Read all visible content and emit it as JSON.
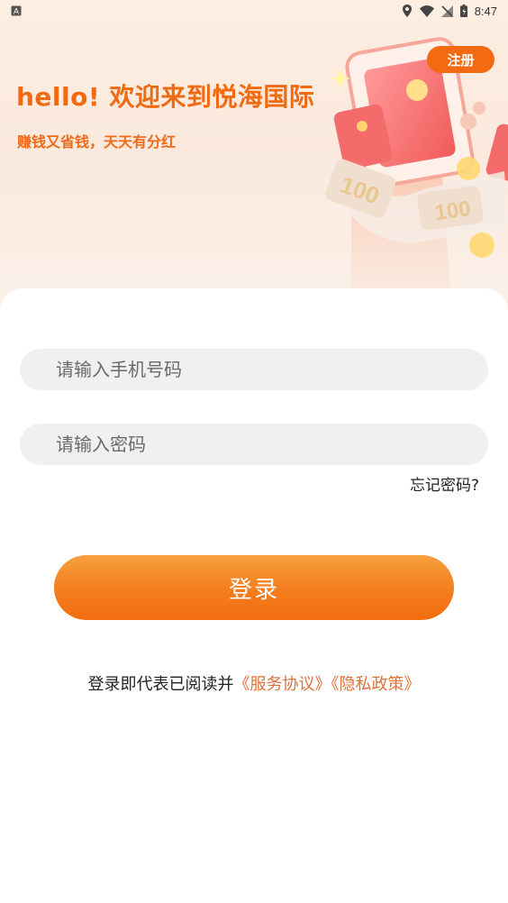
{
  "status_bar": {
    "time": "8:47"
  },
  "header": {
    "title": "hello! 欢迎来到悦海国际",
    "subtitle": "赚钱又省钱，天天有分红",
    "register_label": "注册"
  },
  "illustration": {
    "coin_label_1": "100",
    "coin_label_2": "100"
  },
  "form": {
    "phone_placeholder": "请输入手机号码",
    "phone_value": "",
    "password_placeholder": "请输入密码",
    "password_value": "",
    "forgot_label": "忘记密码?",
    "login_label": "登录"
  },
  "agreement": {
    "prefix": "登录即代表已阅读并",
    "service_link": "《服务协议》",
    "privacy_link": "《隐私政策》"
  },
  "colors": {
    "accent": "#f46a10",
    "link": "#e0703a",
    "input_bg": "#f0f0f0"
  }
}
